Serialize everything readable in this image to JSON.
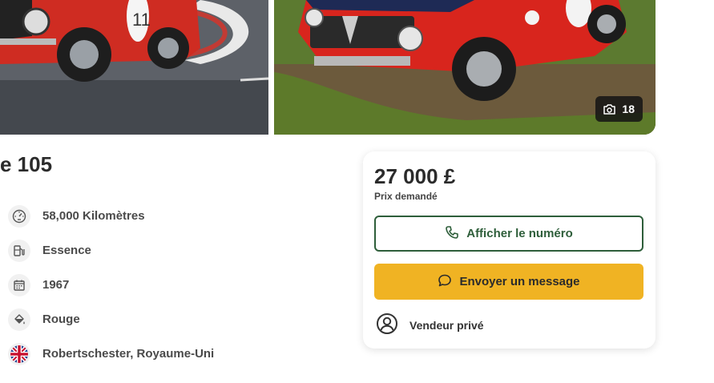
{
  "gallery": {
    "photo_count": "18",
    "icons": {
      "camera": "camera-icon"
    }
  },
  "listing": {
    "title": "e 105"
  },
  "specs": [
    {
      "icon": "odometer-icon",
      "label": "58,000 Kilomètres"
    },
    {
      "icon": "fuel-pump-icon",
      "label": "Essence"
    },
    {
      "icon": "calendar-icon",
      "label": "1967"
    },
    {
      "icon": "paint-bucket-icon",
      "label": "Rouge"
    },
    {
      "icon": "uk-flag-icon",
      "label": "Robertschester, Royaume-Uni"
    }
  ],
  "price_card": {
    "price": "27 000 £",
    "price_label": "Prix demandé",
    "show_number_label": "Afficher le numéro",
    "send_message_label": "Envoyer un message",
    "seller_type": "Vendeur privé"
  },
  "colors": {
    "accent_green": "#2e5e3a",
    "accent_yellow": "#f0b323",
    "car_red": "#d8251d"
  }
}
